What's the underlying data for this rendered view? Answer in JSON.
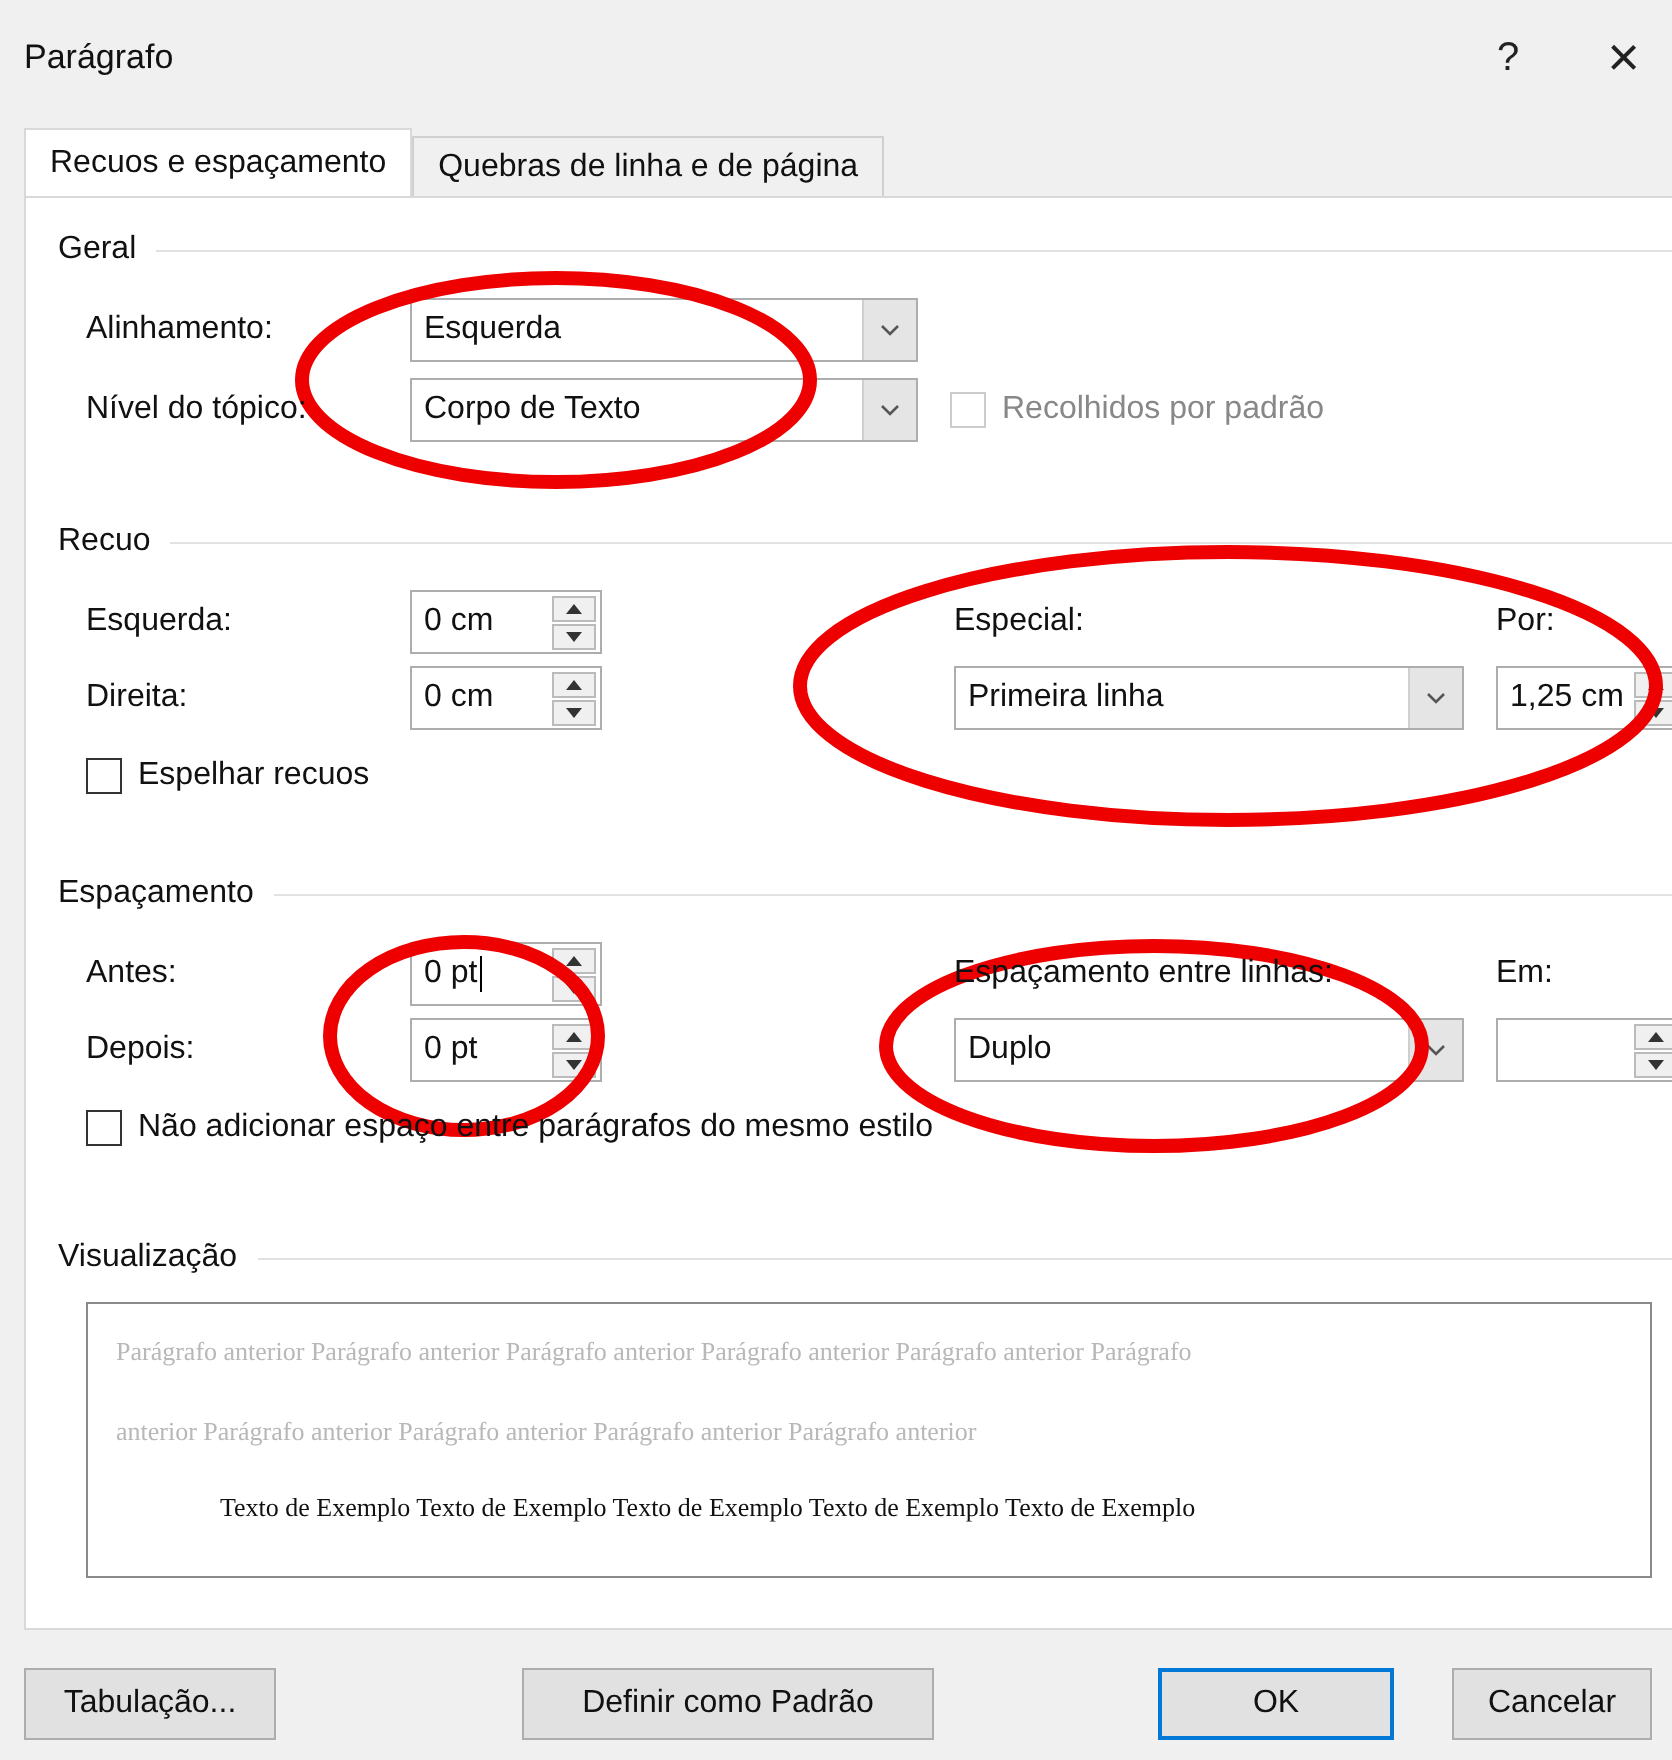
{
  "window": {
    "title": "Parágrafo",
    "help": "?",
    "close": "×"
  },
  "tabs": [
    {
      "label": "Recuos e espaçamento",
      "selected": true
    },
    {
      "label": "Quebras de linha e de página",
      "selected": false
    }
  ],
  "general": {
    "title": "Geral",
    "alignment": {
      "label": "Alinhamento:",
      "value": "Esquerda"
    },
    "outline_level": {
      "label": "Nível do tópico:",
      "value": "Corpo de Texto"
    },
    "collapsed": {
      "label": "Recolhidos por padrão",
      "checked": false,
      "disabled": true
    }
  },
  "indent": {
    "title": "Recuo",
    "left": {
      "label": "Esquerda:",
      "value": "0 cm"
    },
    "right": {
      "label": "Direita:",
      "value": "0 cm"
    },
    "special": {
      "label": "Especial:",
      "value": "Primeira linha"
    },
    "by": {
      "label": "Por:",
      "value": "1,25 cm"
    },
    "mirror": {
      "label": "Espelhar recuos",
      "checked": false,
      "disabled": false
    }
  },
  "spacing": {
    "title": "Espaçamento",
    "before": {
      "label": "Antes:",
      "value": "0 pt",
      "focused": true
    },
    "after": {
      "label": "Depois:",
      "value": "0 pt",
      "focused": false
    },
    "line_spacing": {
      "label": "Espaçamento entre linhas:",
      "value": "Duplo"
    },
    "at": {
      "label": "Em:"
    },
    "no_space": {
      "label": "Não adicionar espaço entre parágrafos do mesmo estilo",
      "checked": false,
      "disabled": false
    }
  },
  "preview": {
    "title": "Visualização",
    "previous_lines": [
      "Parágrafo anterior Parágrafo anterior Parágrafo anterior Parágrafo anterior Parágrafo anterior Parágrafo",
      "anterior Parágrafo anterior Parágrafo anterior Parágrafo anterior Parágrafo anterior"
    ],
    "sample_text": "Texto de Exemplo Texto de Exemplo Texto de Exemplo Texto de Exemplo Texto de Exemplo"
  },
  "buttons": [
    {
      "label": "Tabulação...",
      "default": false
    },
    {
      "label": "Definir como Padrão",
      "default": false
    },
    {
      "label": "OK",
      "default": true
    },
    {
      "label": "Cancelar",
      "default": false
    }
  ]
}
